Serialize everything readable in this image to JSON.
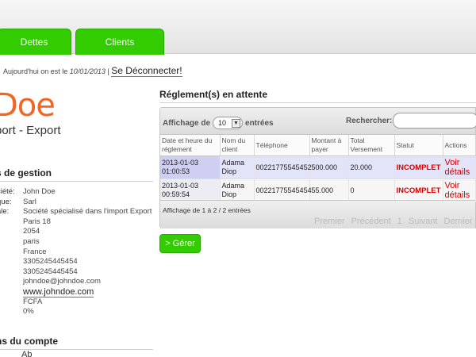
{
  "nav": {
    "tabs": [
      {
        "label": "Dettes"
      },
      {
        "label": "Clients"
      }
    ]
  },
  "infobar": {
    "prefix": "Aujourd'hui on est le",
    "date": "10/01/2013",
    "separator": "|",
    "logout": "Se Déconnecter!"
  },
  "company": {
    "logo": "Doe",
    "tagline": "port - Export"
  },
  "gestion": {
    "title": "s de gestion",
    "labels": [
      "ciété:",
      "que:",
      "ale:",
      ":"
    ],
    "values": [
      "John Doe",
      "Sarl",
      "Société spécialisé dans l'import Export",
      "Paris 18",
      "2054",
      "paris",
      "France",
      "3305245445454",
      "3305245445454",
      "johndoe@johndoe.com"
    ],
    "website": "www.johndoe.com",
    "currency": "FCFA",
    "rate": "0%"
  },
  "compte": {
    "title": "ns du compte",
    "value": "Ab"
  },
  "main": {
    "title": "Réglement(s) en attente",
    "length_prefix": "Affichage de",
    "length_value": "10",
    "length_suffix": "entrées",
    "search_label": "Rechercher:",
    "search_value": "",
    "columns": [
      "Date et heure du réglement",
      "Nom du client",
      "Téléphone",
      "Montant à payer",
      "Total Versement",
      "Statut",
      "Actions"
    ],
    "rows": [
      {
        "date": "2013-01-03 01:00:53",
        "client": "Adama Diop",
        "phone": "00221775545452",
        "amount": "500.000",
        "total": "20.000",
        "status": "INCOMPLET",
        "action": "Voir détails"
      },
      {
        "date": "2013-01-03 00:59:54",
        "client": "Adama Diop",
        "phone": "00221775545454",
        "amount": "55.000",
        "total": "0",
        "status": "INCOMPLET",
        "action": "Voir détails"
      }
    ],
    "info": "Affichage de 1 à 2 / 2 entrées",
    "pager": {
      "first": "Premier",
      "prev": "Précédent",
      "page": "1",
      "next": "Suivant",
      "last": "Dernier"
    },
    "button": "> Gérer"
  },
  "colors": {
    "accent": "#33cc00",
    "logo": "#f26522",
    "status": "#d40000"
  }
}
